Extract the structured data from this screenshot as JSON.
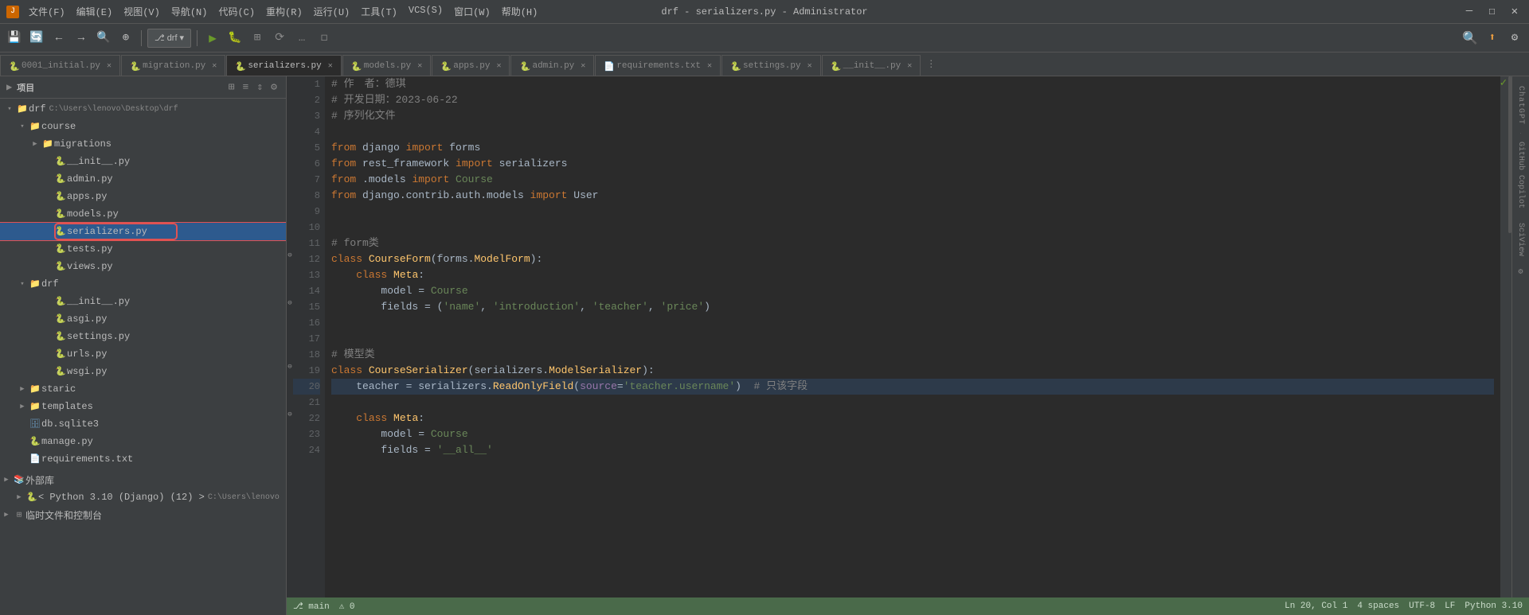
{
  "titlebar": {
    "title": "drf - serializers.py - Administrator",
    "menus": [
      "文件(F)",
      "编辑(E)",
      "视图(V)",
      "导航(N)",
      "代码(C)",
      "重构(R)",
      "运行(U)",
      "工具(T)",
      "VCS(S)",
      "窗口(W)",
      "帮助(H)"
    ],
    "controls": [
      "—",
      "☐",
      "✕"
    ]
  },
  "toolbar": {
    "project_btn": "项目",
    "branch_btn": "drf",
    "run_icon": "▶",
    "debug_icon": "🐛",
    "coverage_icon": "⊞",
    "profile_icon": "⟳",
    "more_icon": "…",
    "search_icon": "🔍",
    "update_icon": "⬆",
    "settings_icon": "⚙"
  },
  "tabs": [
    {
      "label": "0001_initial.py",
      "active": false,
      "icon_color": "#6897bb"
    },
    {
      "label": "migration.py",
      "active": false,
      "icon_color": "#6897bb"
    },
    {
      "label": "serializers.py",
      "active": true,
      "icon_color": "#6897bb"
    },
    {
      "label": "models.py",
      "active": false,
      "icon_color": "#6897bb"
    },
    {
      "label": "apps.py",
      "active": false,
      "icon_color": "#6897bb"
    },
    {
      "label": "admin.py",
      "active": false,
      "icon_color": "#6897bb"
    },
    {
      "label": "requirements.txt",
      "active": false,
      "icon_color": "#888"
    },
    {
      "label": "settings.py",
      "active": false,
      "icon_color": "#6897bb"
    },
    {
      "label": "__init__.py",
      "active": false,
      "icon_color": "#6897bb"
    }
  ],
  "sidebar": {
    "title": "项目",
    "icons": [
      "⊞",
      "≡",
      "⇕",
      "⚙"
    ],
    "tree": [
      {
        "type": "root",
        "label": "drf",
        "path": "C:\\Users\\lenovo\\Desktop\\drf",
        "level": 0,
        "expanded": true
      },
      {
        "type": "folder",
        "label": "course",
        "level": 1,
        "expanded": true
      },
      {
        "type": "folder",
        "label": "migrations",
        "level": 2,
        "expanded": false
      },
      {
        "type": "file",
        "label": "__init__.py",
        "level": 2,
        "ext": "py"
      },
      {
        "type": "file",
        "label": "admin.py",
        "level": 2,
        "ext": "py"
      },
      {
        "type": "file",
        "label": "apps.py",
        "level": 2,
        "ext": "py"
      },
      {
        "type": "file",
        "label": "models.py",
        "level": 2,
        "ext": "py"
      },
      {
        "type": "file",
        "label": "serializers.py",
        "level": 2,
        "ext": "py",
        "selected": true
      },
      {
        "type": "file",
        "label": "tests.py",
        "level": 2,
        "ext": "py"
      },
      {
        "type": "file",
        "label": "views.py",
        "level": 2,
        "ext": "py"
      },
      {
        "type": "folder",
        "label": "drf",
        "level": 1,
        "expanded": true
      },
      {
        "type": "file",
        "label": "__init__.py",
        "level": 2,
        "ext": "py"
      },
      {
        "type": "file",
        "label": "asgi.py",
        "level": 2,
        "ext": "py"
      },
      {
        "type": "file",
        "label": "settings.py",
        "level": 2,
        "ext": "py"
      },
      {
        "type": "file",
        "label": "urls.py",
        "level": 2,
        "ext": "py"
      },
      {
        "type": "file",
        "label": "wsgi.py",
        "level": 2,
        "ext": "py"
      },
      {
        "type": "folder",
        "label": "staric",
        "level": 1,
        "expanded": false
      },
      {
        "type": "folder",
        "label": "templates",
        "level": 1,
        "expanded": false
      },
      {
        "type": "file",
        "label": "db.sqlite3",
        "level": 1,
        "ext": "db"
      },
      {
        "type": "file",
        "label": "manage.py",
        "level": 1,
        "ext": "py"
      },
      {
        "type": "file",
        "label": "requirements.txt",
        "level": 1,
        "ext": "txt"
      },
      {
        "type": "group",
        "label": "外部库",
        "level": 0,
        "expanded": false
      },
      {
        "type": "item",
        "label": "< Python 3.10 (Django) (12) >",
        "path": "C:\\Users\\lenovo",
        "level": 1
      },
      {
        "type": "item",
        "label": "临时文件和控制台",
        "level": 0
      }
    ]
  },
  "editor": {
    "filename": "serializers.py",
    "lines": [
      {
        "num": 1,
        "content": "# 作　者：德琪",
        "tokens": [
          {
            "type": "cmt",
            "text": "# 作　者：德琪"
          }
        ]
      },
      {
        "num": 2,
        "content": "# 开发日期：2023-06-22",
        "tokens": [
          {
            "type": "cmt",
            "text": "# 开发日期：2023-06-22"
          }
        ]
      },
      {
        "num": 3,
        "content": "# 序列化文件",
        "tokens": [
          {
            "type": "cmt",
            "text": "# 序列化文件"
          }
        ]
      },
      {
        "num": 4,
        "content": ""
      },
      {
        "num": 5,
        "content": "from django import forms"
      },
      {
        "num": 6,
        "content": "from rest_framework import serializers"
      },
      {
        "num": 7,
        "content": "from .models import Course"
      },
      {
        "num": 8,
        "content": "from django.contrib.auth.models import User"
      },
      {
        "num": 9,
        "content": ""
      },
      {
        "num": 10,
        "content": ""
      },
      {
        "num": 11,
        "content": "# form类"
      },
      {
        "num": 12,
        "content": "class CourseForm(forms.ModelForm):"
      },
      {
        "num": 13,
        "content": "    class Meta:"
      },
      {
        "num": 14,
        "content": "        model = Course"
      },
      {
        "num": 15,
        "content": "        fields = ('name', 'introduction', 'teacher', 'price')"
      },
      {
        "num": 16,
        "content": ""
      },
      {
        "num": 17,
        "content": ""
      },
      {
        "num": 18,
        "content": "# 模型类"
      },
      {
        "num": 19,
        "content": "class CourseSerializer(serializers.ModelSerializer):"
      },
      {
        "num": 20,
        "content": "    teacher = serializers.ReadOnlyField(source='teacher.username')  # 只该字段"
      },
      {
        "num": 21,
        "content": ""
      },
      {
        "num": 22,
        "content": "    class Meta:"
      },
      {
        "num": 23,
        "content": "        model = Course"
      },
      {
        "num": 24,
        "content": "        fields = '__all__'"
      }
    ]
  },
  "statusbar": {
    "left_items": [],
    "right_items": [
      "UTF-8",
      "LF",
      "Python 3.10",
      "4 spaces",
      "Ln 20, Col 1"
    ]
  },
  "right_sidebar": {
    "buttons": [
      "ChatGPT",
      "GitHub Copilot",
      "SciView",
      "⚙"
    ]
  }
}
